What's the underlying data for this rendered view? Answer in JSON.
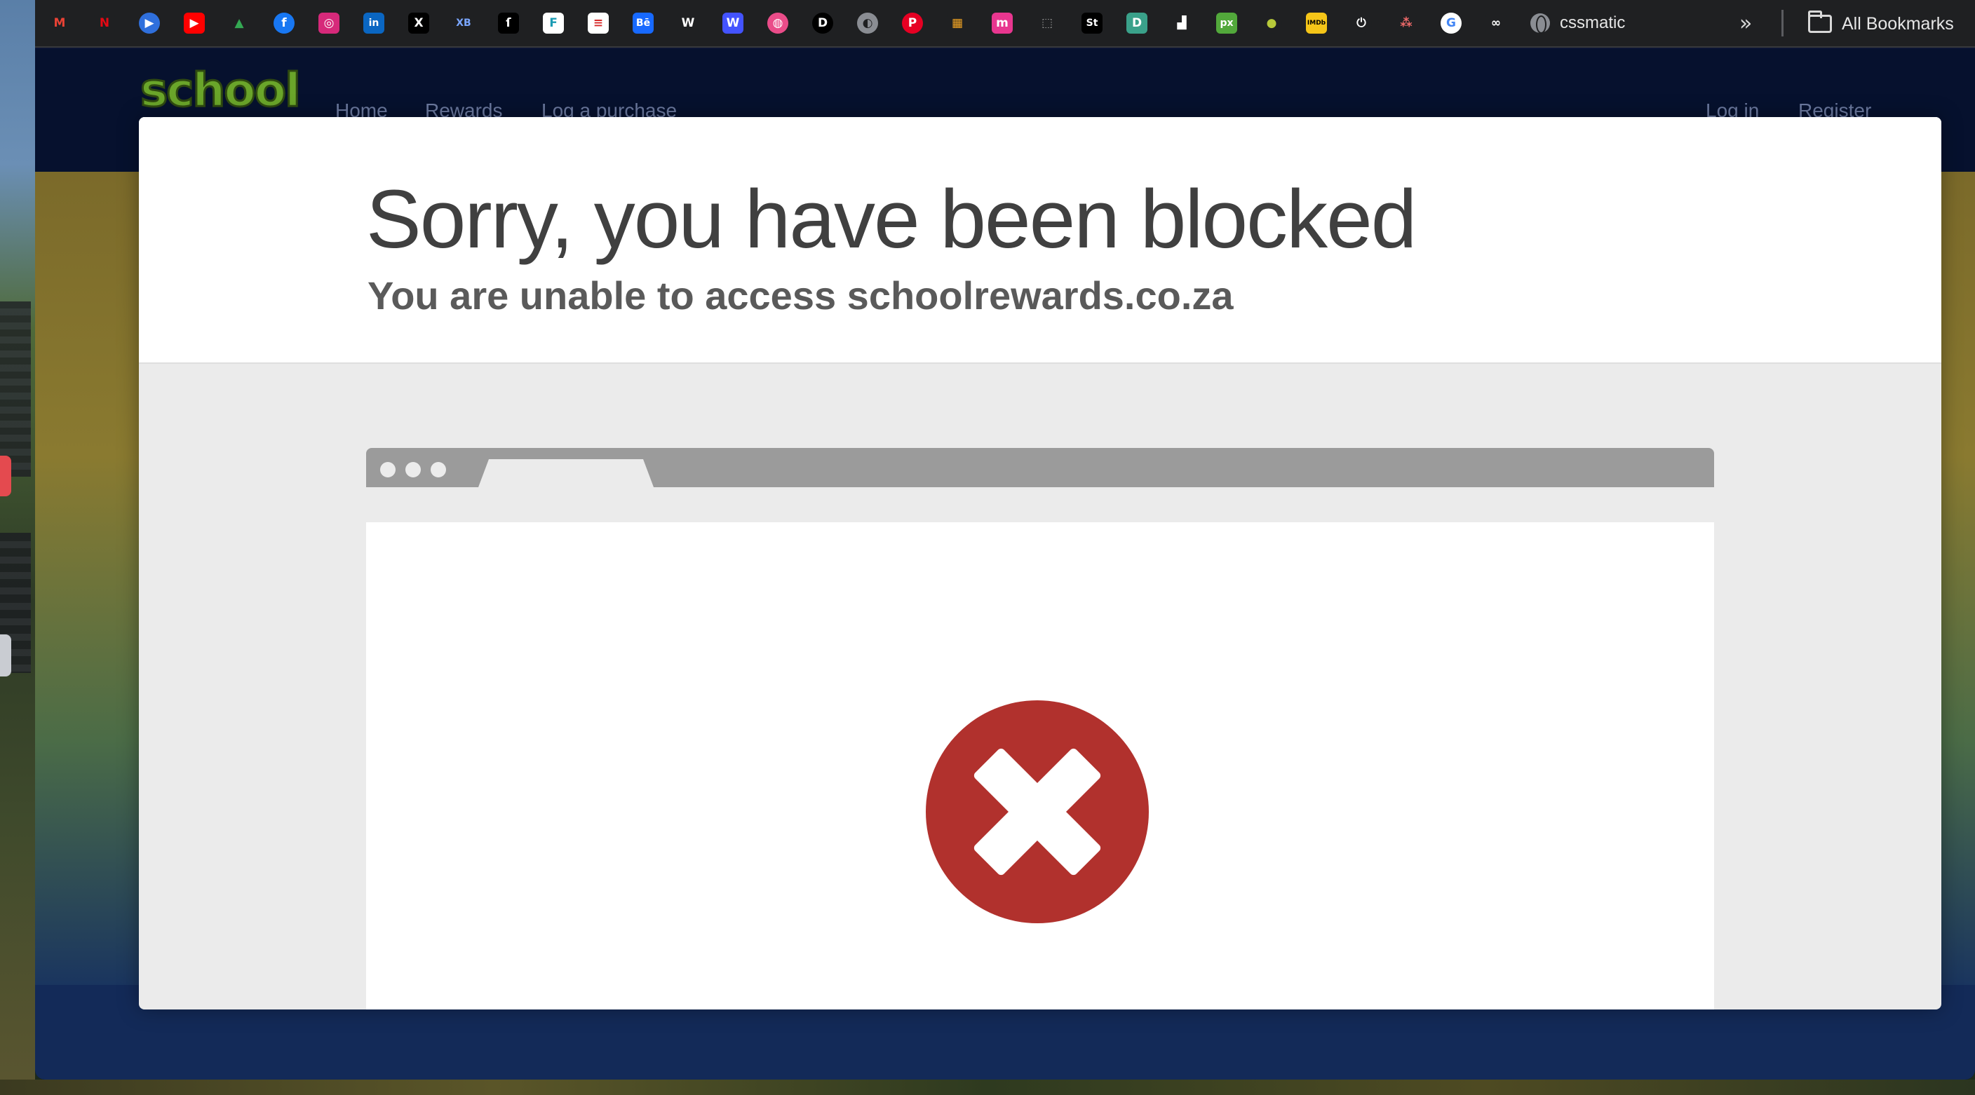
{
  "bookmarks": {
    "items": [
      {
        "name": "gmail-icon",
        "glyph": "M",
        "bg": "#1f2022",
        "fg": "#e94235"
      },
      {
        "name": "netflix-icon",
        "glyph": "N",
        "bg": "#1f2022",
        "fg": "#e50914"
      },
      {
        "name": "play-icon",
        "glyph": "▶",
        "bg": "#2f6fdc",
        "fg": "#ffffff",
        "round": true
      },
      {
        "name": "youtube-icon",
        "glyph": "▶",
        "bg": "#ff0000",
        "fg": "#ffffff"
      },
      {
        "name": "drive-icon",
        "glyph": "▲",
        "bg": "#1f2022",
        "fg": "#34a853"
      },
      {
        "name": "facebook-icon",
        "glyph": "f",
        "bg": "#1877f2",
        "fg": "#ffffff",
        "round": true
      },
      {
        "name": "instagram-icon",
        "glyph": "◎",
        "bg": "#d6297a",
        "fg": "#ffffff"
      },
      {
        "name": "linkedin-icon",
        "glyph": "in",
        "bg": "#0a66c2",
        "fg": "#ffffff"
      },
      {
        "name": "x-icon",
        "glyph": "X",
        "bg": "#000000",
        "fg": "#ffffff"
      },
      {
        "name": "xb-icon",
        "glyph": "XB",
        "bg": "#1f2022",
        "fg": "#7aa6ff"
      },
      {
        "name": "script-icon",
        "glyph": "ſ",
        "bg": "#000000",
        "fg": "#ffffff"
      },
      {
        "name": "f-icon",
        "glyph": "F",
        "bg": "#ffffff",
        "fg": "#1a9bb3"
      },
      {
        "name": "flag-icon",
        "glyph": "≡",
        "bg": "#ffffff",
        "fg": "#d62828"
      },
      {
        "name": "behance-icon",
        "glyph": "Bē",
        "bg": "#1769ff",
        "fg": "#ffffff"
      },
      {
        "name": "w-black-icon",
        "glyph": "W",
        "bg": "#1f2022",
        "fg": "#ffffff"
      },
      {
        "name": "webflow-icon",
        "glyph": "W",
        "bg": "#4353ff",
        "fg": "#ffffff"
      },
      {
        "name": "dribbble-icon",
        "glyph": "◍",
        "bg": "#ea4c89",
        "fg": "#ffffff",
        "round": true
      },
      {
        "name": "d-icon",
        "glyph": "D",
        "bg": "#000000",
        "fg": "#ffffff",
        "round": true
      },
      {
        "name": "globe-icon",
        "glyph": "◐",
        "bg": "#8a8d93",
        "fg": "#1f2022",
        "round": true
      },
      {
        "name": "pinterest-icon",
        "glyph": "P",
        "bg": "#e60023",
        "fg": "#ffffff",
        "round": true
      },
      {
        "name": "store-icon",
        "glyph": "▦",
        "bg": "#1f2022",
        "fg": "#f5a623"
      },
      {
        "name": "m-icon",
        "glyph": "m",
        "bg": "#e8368f",
        "fg": "#ffffff"
      },
      {
        "name": "dotted-square-icon",
        "glyph": "⬚",
        "bg": "#1f2022",
        "fg": "#9a9a9a"
      },
      {
        "name": "st-icon",
        "glyph": "St",
        "bg": "#000000",
        "fg": "#ffffff"
      },
      {
        "name": "green-d-icon",
        "glyph": "D",
        "bg": "#3aa18a",
        "fg": "#ffffff"
      },
      {
        "name": "unsplash-icon",
        "glyph": "▟",
        "bg": "#1f2022",
        "fg": "#ffffff"
      },
      {
        "name": "px-icon",
        "glyph": "px",
        "bg": "#52a83b",
        "fg": "#ffffff"
      },
      {
        "name": "tennis-icon",
        "glyph": "●",
        "bg": "#1f2022",
        "fg": "#b7c93a",
        "round": true
      },
      {
        "name": "imdb-icon",
        "glyph": "IMDb",
        "bg": "#f5c518",
        "fg": "#000000"
      },
      {
        "name": "power-icon",
        "glyph": "⏻",
        "bg": "#1f2022",
        "fg": "#ffffff",
        "round": true
      },
      {
        "name": "asana-icon",
        "glyph": "⁂",
        "bg": "#1f2022",
        "fg": "#f06a6a"
      },
      {
        "name": "google-icon",
        "glyph": "G",
        "bg": "#ffffff",
        "fg": "#4285f4",
        "round": true
      },
      {
        "name": "infinity-icon",
        "glyph": "∞",
        "bg": "#1f2022",
        "fg": "#ffffff"
      }
    ],
    "named_label": "cssmatic",
    "more": "»",
    "all_bookmarks_label": "All Bookmarks"
  },
  "site": {
    "logo": "school",
    "nav": [
      "Home",
      "Rewards",
      "Log a purchase"
    ],
    "nav_right": [
      "Log in",
      "Register"
    ]
  },
  "block_page": {
    "title": "Sorry, you have been blocked",
    "subtitle": "You are unable to access schoolrewards.co.za",
    "error_color": "#b1312d"
  }
}
